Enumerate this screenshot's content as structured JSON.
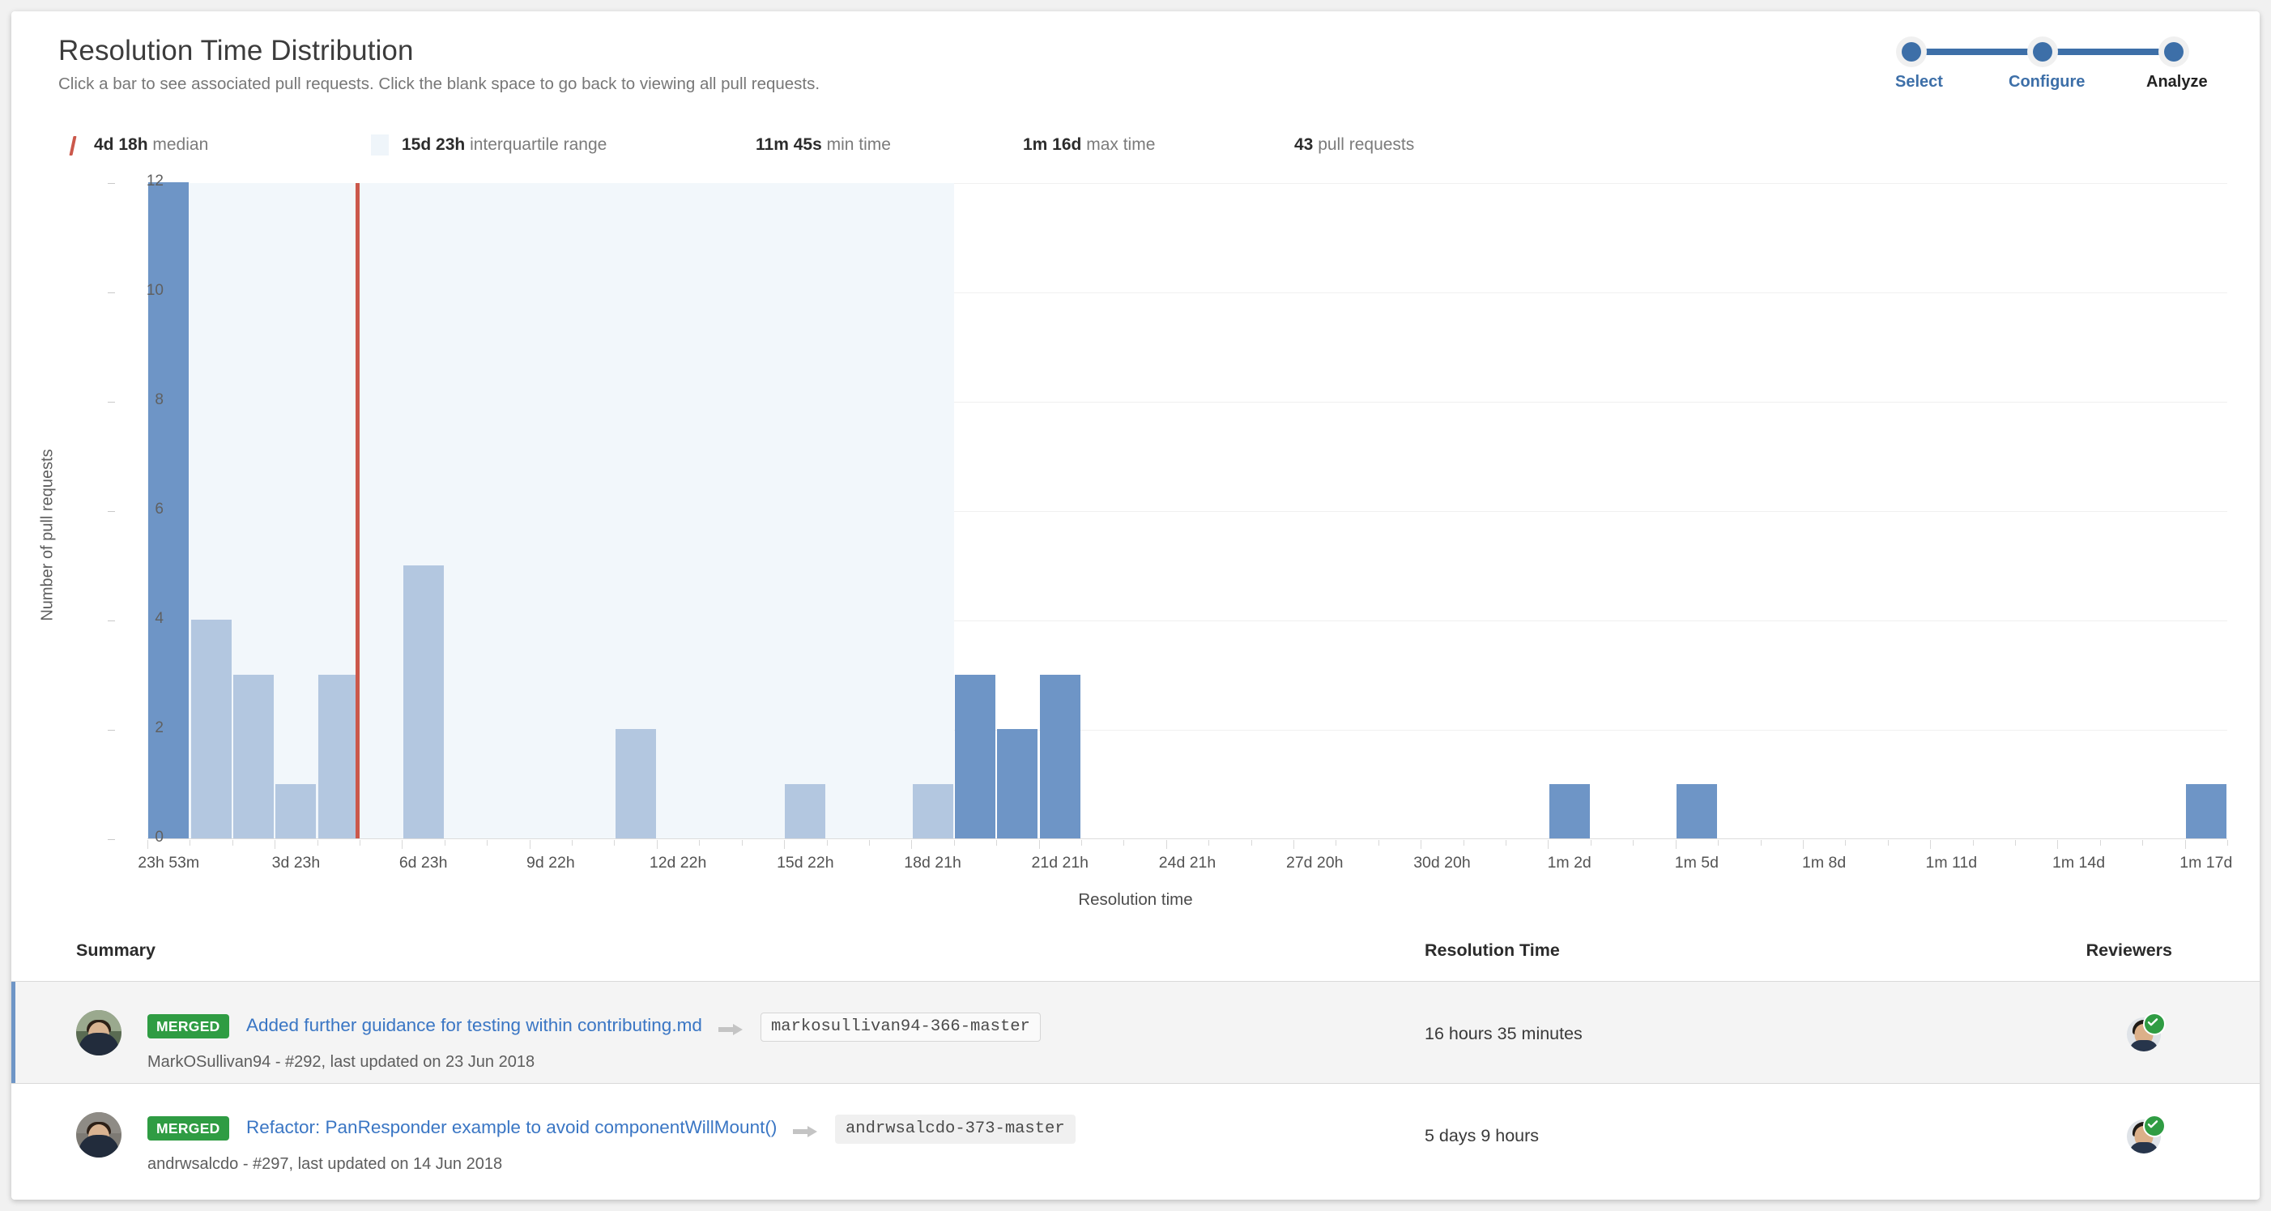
{
  "header": {
    "title": "Resolution Time Distribution",
    "subtitle": "Click a bar to see associated pull requests. Click the blank space to go back to viewing all pull requests."
  },
  "stepper": {
    "steps": [
      {
        "label": "Select",
        "state": "done"
      },
      {
        "label": "Configure",
        "state": "done"
      },
      {
        "label": "Analyze",
        "state": "active"
      }
    ],
    "accent_color": "#3d6fa8"
  },
  "legend": [
    {
      "value": "4d 18h",
      "label": "median",
      "swatch": "median-line",
      "color": "#cb584b"
    },
    {
      "value": "15d 23h",
      "label": "interquartile range",
      "swatch": "iqr-band",
      "color": "#eff5fa"
    },
    {
      "value": "11m 45s",
      "label": "min time",
      "swatch": "none"
    },
    {
      "value": "1m 16d",
      "label": "max time",
      "swatch": "none"
    },
    {
      "value": "43",
      "label": "pull requests",
      "swatch": "none"
    }
  ],
  "chart_data": {
    "type": "bar",
    "title": "Resolution Time Distribution",
    "xlabel": "Resolution time",
    "ylabel": "Number of pull requests",
    "ylim": [
      0,
      12
    ],
    "yticks": [
      0,
      2,
      4,
      6,
      8,
      10,
      12
    ],
    "grid": true,
    "legend_position": "top-left",
    "xtick_labels": [
      "23h 53m",
      "3d 23h",
      "6d 23h",
      "9d 22h",
      "12d 22h",
      "15d 22h",
      "18d 21h",
      "21d 21h",
      "24d 21h",
      "27d 20h",
      "30d 20h",
      "1m 2d",
      "1m 5d",
      "1m 8d",
      "1m 11d",
      "1m 14d",
      "1m 17d"
    ],
    "xtick_index": [
      0,
      3,
      6,
      9,
      12,
      15,
      18,
      21,
      24,
      27,
      30,
      33,
      36,
      39,
      42,
      45,
      48
    ],
    "n_bins": 49,
    "values": [
      12,
      4,
      3,
      1,
      3,
      0,
      5,
      0,
      0,
      0,
      0,
      2,
      0,
      0,
      0,
      1,
      0,
      0,
      1,
      3,
      2,
      3,
      0,
      0,
      0,
      0,
      0,
      0,
      0,
      0,
      0,
      0,
      0,
      1,
      0,
      0,
      1,
      0,
      0,
      0,
      0,
      0,
      0,
      0,
      0,
      0,
      0,
      0,
      1
    ],
    "selected_bins": [
      0,
      19,
      20,
      21,
      33,
      36,
      48
    ],
    "bar_color": "#b3c7e0",
    "bar_color_selected": "#6e95c6",
    "median_value": "4d 18h",
    "median_bin": 4.9,
    "iqr_start_bin": 0,
    "iqr_end_bin": 19,
    "iqr_color": "#f2f7fb",
    "median_color": "#cb584b"
  },
  "table": {
    "columns": {
      "summary": "Summary",
      "resolution_time": "Resolution Time",
      "reviewers": "Reviewers"
    },
    "rows": [
      {
        "status": "MERGED",
        "title": "Added further guidance for testing within contributing.md",
        "branch": "markosullivan94-366-master",
        "meta": "MarkOSullivan94 - #292, last updated on 23 Jun 2018",
        "resolution_time": "16 hours 35 minutes",
        "reviewer_status": "approved"
      },
      {
        "status": "MERGED",
        "title": "Refactor: PanResponder example to avoid componentWillMount()",
        "branch": "andrwsalcdo-373-master",
        "meta": "andrwsalcdo - #297, last updated on 14 Jun 2018",
        "resolution_time": "5 days 9 hours",
        "reviewer_status": "approved"
      }
    ]
  }
}
